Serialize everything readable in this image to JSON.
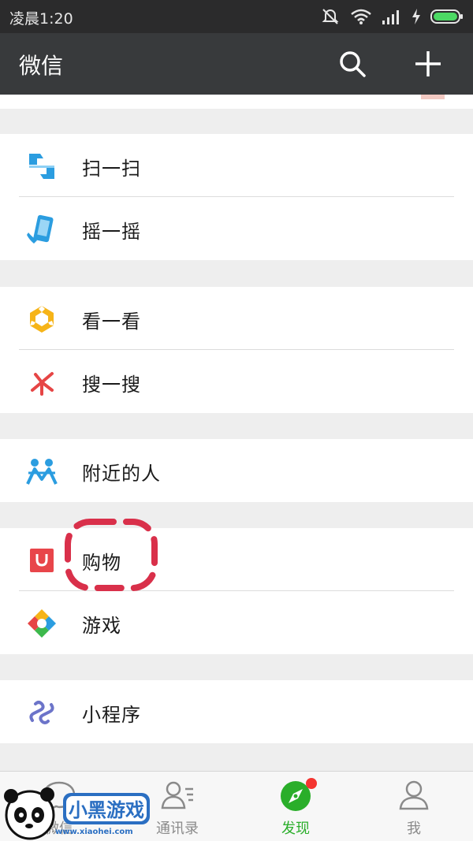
{
  "status_bar": {
    "time": "凌晨1:20",
    "icons": [
      "mute-icon",
      "wifi-icon",
      "signal-icon",
      "charging-icon",
      "battery-icon"
    ]
  },
  "header": {
    "title": "微信",
    "search_icon": "search-icon",
    "add_icon": "plus-icon"
  },
  "menu": {
    "groups": [
      {
        "items": [
          {
            "label": "扫一扫",
            "icon": "scan-icon"
          },
          {
            "label": "摇一摇",
            "icon": "shake-icon"
          }
        ]
      },
      {
        "items": [
          {
            "label": "看一看",
            "icon": "top-stories-icon"
          },
          {
            "label": "搜一搜",
            "icon": "search-discover-icon"
          }
        ]
      },
      {
        "items": [
          {
            "label": "附近的人",
            "icon": "people-nearby-icon"
          }
        ]
      },
      {
        "items": [
          {
            "label": "购物",
            "icon": "shopping-icon"
          },
          {
            "label": "游戏",
            "icon": "games-icon"
          }
        ]
      },
      {
        "items": [
          {
            "label": "小程序",
            "icon": "mini-programs-icon"
          }
        ]
      }
    ]
  },
  "tabs": [
    {
      "label": "微信",
      "icon": "chat-icon"
    },
    {
      "label": "通讯录",
      "icon": "contacts-icon"
    },
    {
      "label": "发现",
      "icon": "compass-icon",
      "active": true,
      "badge": true
    },
    {
      "label": "我",
      "icon": "profile-icon"
    }
  ],
  "watermark": {
    "text": "www.xiaohei.com",
    "logo_text": "小黑游戏"
  },
  "colors": {
    "accent_green": "#2aae2a",
    "badge_red": "#f43530",
    "header_bg": "#383a3c",
    "annotation_red": "#d9304a"
  }
}
